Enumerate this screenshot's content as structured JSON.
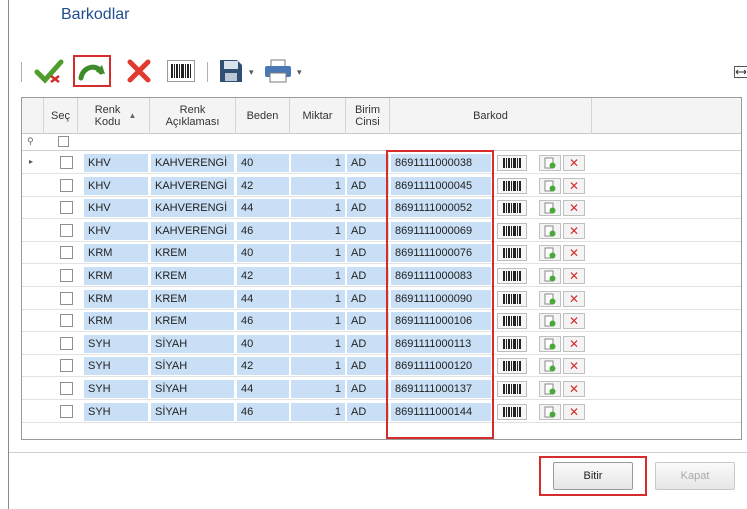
{
  "window": {
    "title": "Barkodlar"
  },
  "toolbar": {
    "buttons": [
      {
        "name": "approve",
        "icon": "check-icon"
      },
      {
        "name": "redo",
        "icon": "redo-arrow-icon"
      },
      {
        "name": "delete",
        "icon": "delete-x-icon"
      },
      {
        "name": "barcode",
        "icon": "barcode-icon"
      },
      {
        "name": "save",
        "icon": "floppy-icon"
      },
      {
        "name": "print",
        "icon": "printer-icon"
      }
    ]
  },
  "grid": {
    "columns": {
      "sec": "Seç",
      "renk_kodu": "Renk Kodu",
      "renk_aciklamasi": "Renk Açıklaması",
      "beden": "Beden",
      "miktar": "Miktar",
      "birim_cinsi": "Birim Cinsi",
      "barkod": "Barkod"
    },
    "rows": [
      {
        "renk_kodu": "KHV",
        "renk_aciklamasi": "KAHVERENGİ",
        "beden": "40",
        "miktar": "1",
        "birim": "AD",
        "barkod": "8691111000038"
      },
      {
        "renk_kodu": "KHV",
        "renk_aciklamasi": "KAHVERENGİ",
        "beden": "42",
        "miktar": "1",
        "birim": "AD",
        "barkod": "8691111000045"
      },
      {
        "renk_kodu": "KHV",
        "renk_aciklamasi": "KAHVERENGİ",
        "beden": "44",
        "miktar": "1",
        "birim": "AD",
        "barkod": "8691111000052"
      },
      {
        "renk_kodu": "KHV",
        "renk_aciklamasi": "KAHVERENGİ",
        "beden": "46",
        "miktar": "1",
        "birim": "AD",
        "barkod": "8691111000069"
      },
      {
        "renk_kodu": "KRM",
        "renk_aciklamasi": "KREM",
        "beden": "40",
        "miktar": "1",
        "birim": "AD",
        "barkod": "8691111000076"
      },
      {
        "renk_kodu": "KRM",
        "renk_aciklamasi": "KREM",
        "beden": "42",
        "miktar": "1",
        "birim": "AD",
        "barkod": "8691111000083"
      },
      {
        "renk_kodu": "KRM",
        "renk_aciklamasi": "KREM",
        "beden": "44",
        "miktar": "1",
        "birim": "AD",
        "barkod": "8691111000090"
      },
      {
        "renk_kodu": "KRM",
        "renk_aciklamasi": "KREM",
        "beden": "46",
        "miktar": "1",
        "birim": "AD",
        "barkod": "8691111000106"
      },
      {
        "renk_kodu": "SYH",
        "renk_aciklamasi": "SİYAH",
        "beden": "40",
        "miktar": "1",
        "birim": "AD",
        "barkod": "8691111000113"
      },
      {
        "renk_kodu": "SYH",
        "renk_aciklamasi": "SİYAH",
        "beden": "42",
        "miktar": "1",
        "birim": "AD",
        "barkod": "8691111000120"
      },
      {
        "renk_kodu": "SYH",
        "renk_aciklamasi": "SİYAH",
        "beden": "44",
        "miktar": "1",
        "birim": "AD",
        "barkod": "8691111000137"
      },
      {
        "renk_kodu": "SYH",
        "renk_aciklamasi": "SİYAH",
        "beden": "46",
        "miktar": "1",
        "birim": "AD",
        "barkod": "8691111000144"
      }
    ]
  },
  "footer": {
    "finish_label": "Bitir",
    "close_label": "Kapat"
  },
  "colors": {
    "highlight": "#d62c2c",
    "cell_blue": "#c8dff5",
    "title": "#1f4e8c"
  }
}
